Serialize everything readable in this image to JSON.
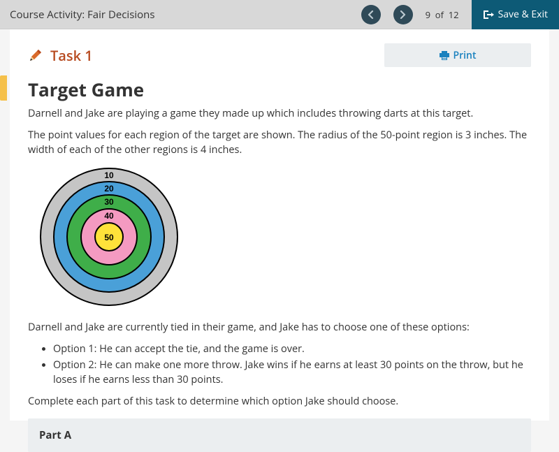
{
  "header": {
    "course_title": "Course Activity: Fair Decisions",
    "page_indicator": "9  of  12",
    "save_exit_label": "Save & Exit"
  },
  "task": {
    "label": "Task 1",
    "print_label": "Print"
  },
  "content": {
    "title": "Target Game",
    "intro": "Darnell and Jake are playing a game they made up which includes throwing darts at this target.",
    "point_values": "The point values for each region of the target are shown. The radius of the 50-point region is 3 inches. The width of each of the other regions is 4 inches.",
    "tied_text": "Darnell and Jake are currently tied in their game, and Jake has to choose one of these options:",
    "option1": "Option 1: He can accept the tie, and the game is over.",
    "option2": "Option 2: He can make one more throw. Jake wins if he earns at least 30 points on the throw, but he loses if he earns less than 30 points.",
    "prompt": "Complete each part of this task to determine which option Jake should choose.",
    "part_a": "Part A"
  },
  "target": {
    "rings": [
      {
        "points": "10",
        "color": "#c5c5c5"
      },
      {
        "points": "20",
        "color": "#4aa0d8"
      },
      {
        "points": "30",
        "color": "#3fae49"
      },
      {
        "points": "40",
        "color": "#f49ac1"
      },
      {
        "points": "50",
        "color": "#ffe23a"
      }
    ]
  }
}
